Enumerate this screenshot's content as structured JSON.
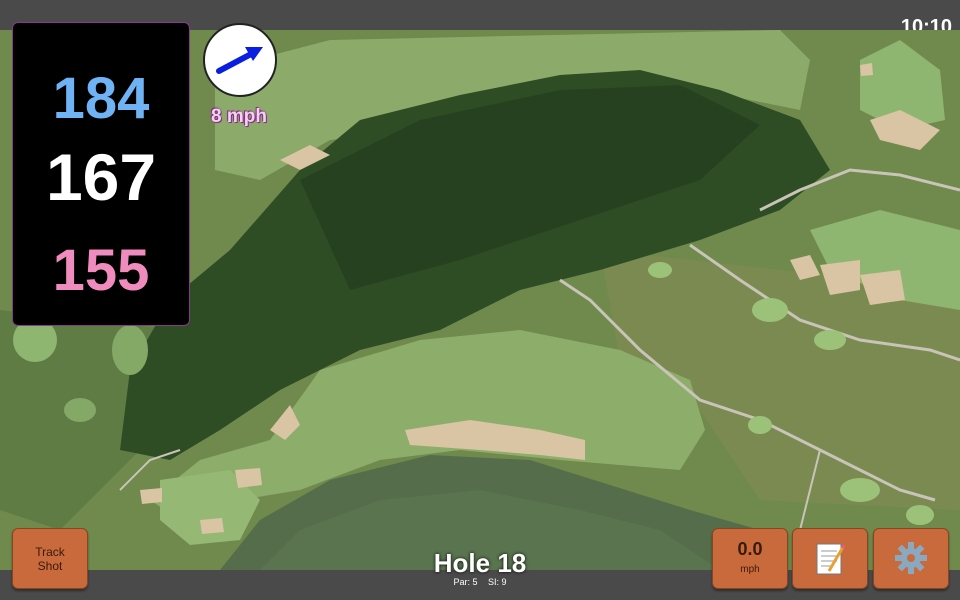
{
  "status": {
    "time": "10:10"
  },
  "distances": {
    "back": "184",
    "middle": "167",
    "front": "155"
  },
  "wind": {
    "speed_label": "8 mph",
    "icon": "wind-direction-arrow-icon"
  },
  "hole": {
    "title": "Hole 18",
    "par_label": "Par: 5",
    "si_label": "SI: 9"
  },
  "buttons": {
    "track_shot_line1": "Track",
    "track_shot_line2": "Shot",
    "speed_value": "0.0",
    "speed_unit": "mph",
    "notes_icon": "notepad-icon",
    "settings_icon": "gear-icon"
  },
  "colors": {
    "back_distance": "#6fb3f5",
    "middle_distance": "#ffffff",
    "front_distance": "#f08bbd",
    "button": "#c96a3c",
    "bar": "#4a4a4a"
  }
}
